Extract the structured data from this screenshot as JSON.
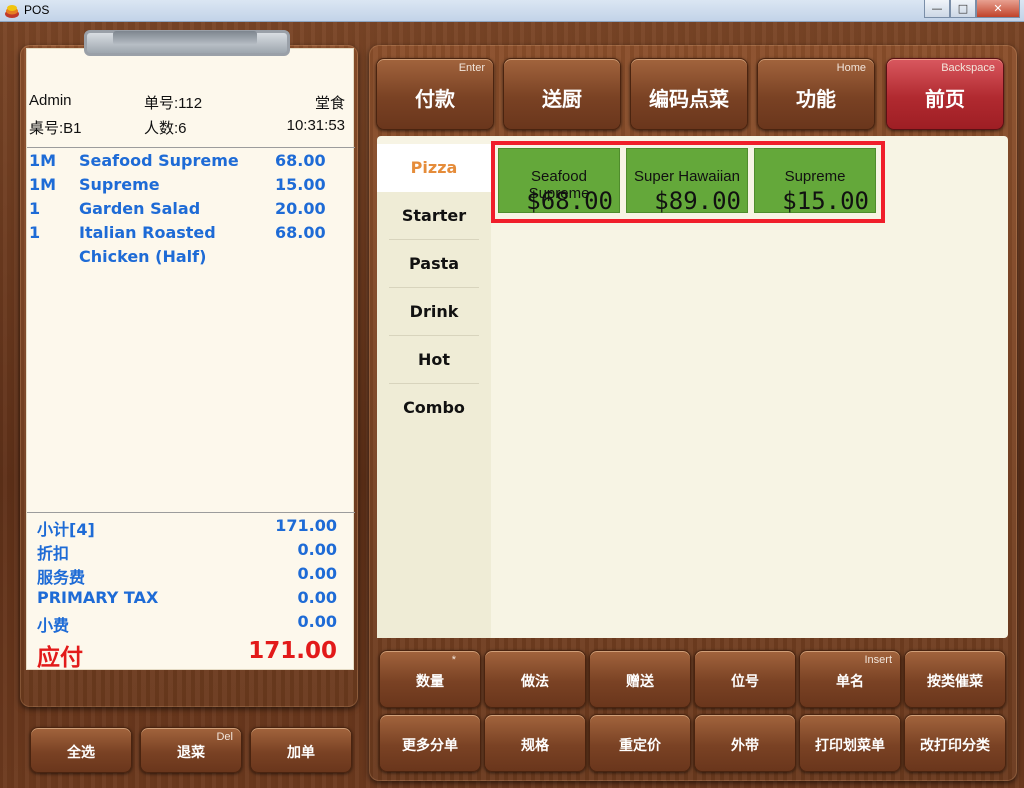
{
  "window": {
    "title": "POS",
    "min": "—",
    "max": "□",
    "close": "✕"
  },
  "order": {
    "operator": "Admin",
    "order_no": "单号:112",
    "dine_type": "堂食",
    "table": "桌号:B1",
    "guests": "人数:6",
    "time": "10:31:53",
    "items": [
      {
        "qty": "1M",
        "name": "Seafood Supreme",
        "price": "68.00"
      },
      {
        "qty": "1M",
        "name": "Supreme",
        "price": "15.00"
      },
      {
        "qty": "1",
        "name": "Garden Salad",
        "price": "20.00"
      },
      {
        "qty": "1",
        "name": "Italian Roasted",
        "price": "68.00"
      },
      {
        "qty": "",
        "name": "Chicken (Half)",
        "price": ""
      }
    ],
    "totals": {
      "subtotal_label": "小计[4]",
      "subtotal": "171.00",
      "discount_label": "折扣",
      "discount": "0.00",
      "service_label": "服务费",
      "service": "0.00",
      "tax_label": "PRIMARY TAX",
      "tax": "0.00",
      "tip_label": "小费",
      "tip": "0.00",
      "due_label": "应付",
      "due": "171.00"
    }
  },
  "left_buttons": {
    "select_all": "全选",
    "return": "退菜",
    "return_key": "Del",
    "add_order": "加单"
  },
  "top_buttons": {
    "pay": "付款",
    "pay_key": "Enter",
    "send_kitchen": "送厨",
    "code_order": "编码点菜",
    "functions": "功能",
    "functions_key": "Home",
    "front_page": "前页",
    "front_page_key": "Backspace"
  },
  "categories": [
    "Pizza",
    "Starter",
    "Pasta",
    "Drink",
    "Hot Combo"
  ],
  "active_category": "Pizza",
  "dishes": [
    {
      "name": "Seafood Supreme",
      "price": "$68.00"
    },
    {
      "name": "Super Hawaiian",
      "price": "$89.00"
    },
    {
      "name": "Supreme",
      "price": "$15.00"
    }
  ],
  "bottom_buttons": {
    "quantity": "数量",
    "quantity_key": "*",
    "method": "做法",
    "gift": "赠送",
    "seat": "位号",
    "item_name": "单名",
    "item_name_key": "Insert",
    "urge_by_category": "按类催菜",
    "more_split": "更多分单",
    "spec": "规格",
    "reprice": "重定价",
    "takeaway": "外带",
    "print_list": "打印划菜单",
    "change_print_category": "改打印分类"
  },
  "colors": {
    "accent_red": "#f01e2a",
    "item_blue": "#1e6bd6",
    "due_red": "#e21a1a",
    "dish_green": "#64a83a",
    "active_cat": "#e58c3a"
  }
}
